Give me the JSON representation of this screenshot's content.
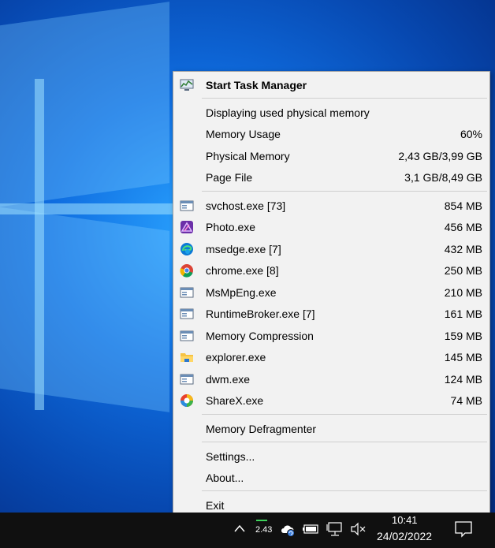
{
  "menu": {
    "title": "Start Task Manager",
    "stats": {
      "heading": "Displaying used physical memory",
      "memory_usage": {
        "label": "Memory Usage",
        "value": "60%"
      },
      "physical_memory": {
        "label": "Physical Memory",
        "value": "2,43 GB/3,99 GB"
      },
      "page_file": {
        "label": "Page File",
        "value": "3,1 GB/8,49 GB"
      }
    },
    "processes": [
      {
        "name": "svchost.exe [73]",
        "value": "854 MB",
        "icon": "generic-app-icon"
      },
      {
        "name": "Photo.exe",
        "value": "456 MB",
        "icon": "affinity-photo-icon"
      },
      {
        "name": "msedge.exe [7]",
        "value": "432 MB",
        "icon": "edge-icon"
      },
      {
        "name": "chrome.exe [8]",
        "value": "250 MB",
        "icon": "chrome-icon"
      },
      {
        "name": "MsMpEng.exe",
        "value": "210 MB",
        "icon": "generic-app-icon"
      },
      {
        "name": "RuntimeBroker.exe [7]",
        "value": "161 MB",
        "icon": "generic-app-icon"
      },
      {
        "name": "Memory Compression",
        "value": "159 MB",
        "icon": "generic-app-icon"
      },
      {
        "name": "explorer.exe",
        "value": "145 MB",
        "icon": "folder-icon"
      },
      {
        "name": "dwm.exe",
        "value": "124 MB",
        "icon": "generic-app-icon"
      },
      {
        "name": "ShareX.exe",
        "value": "74 MB",
        "icon": "sharex-icon"
      }
    ],
    "defragmenter": "Memory Defragmenter",
    "settings": "Settings...",
    "about": "About...",
    "exit": "Exit"
  },
  "taskbar": {
    "tray_text": "2.43",
    "time": "10:41",
    "date": "24/02/2022"
  },
  "colors": {
    "menu_bg": "#f2f2f2",
    "taskbar_bg": "#101010",
    "desktop_accent": "#0f6de0"
  }
}
